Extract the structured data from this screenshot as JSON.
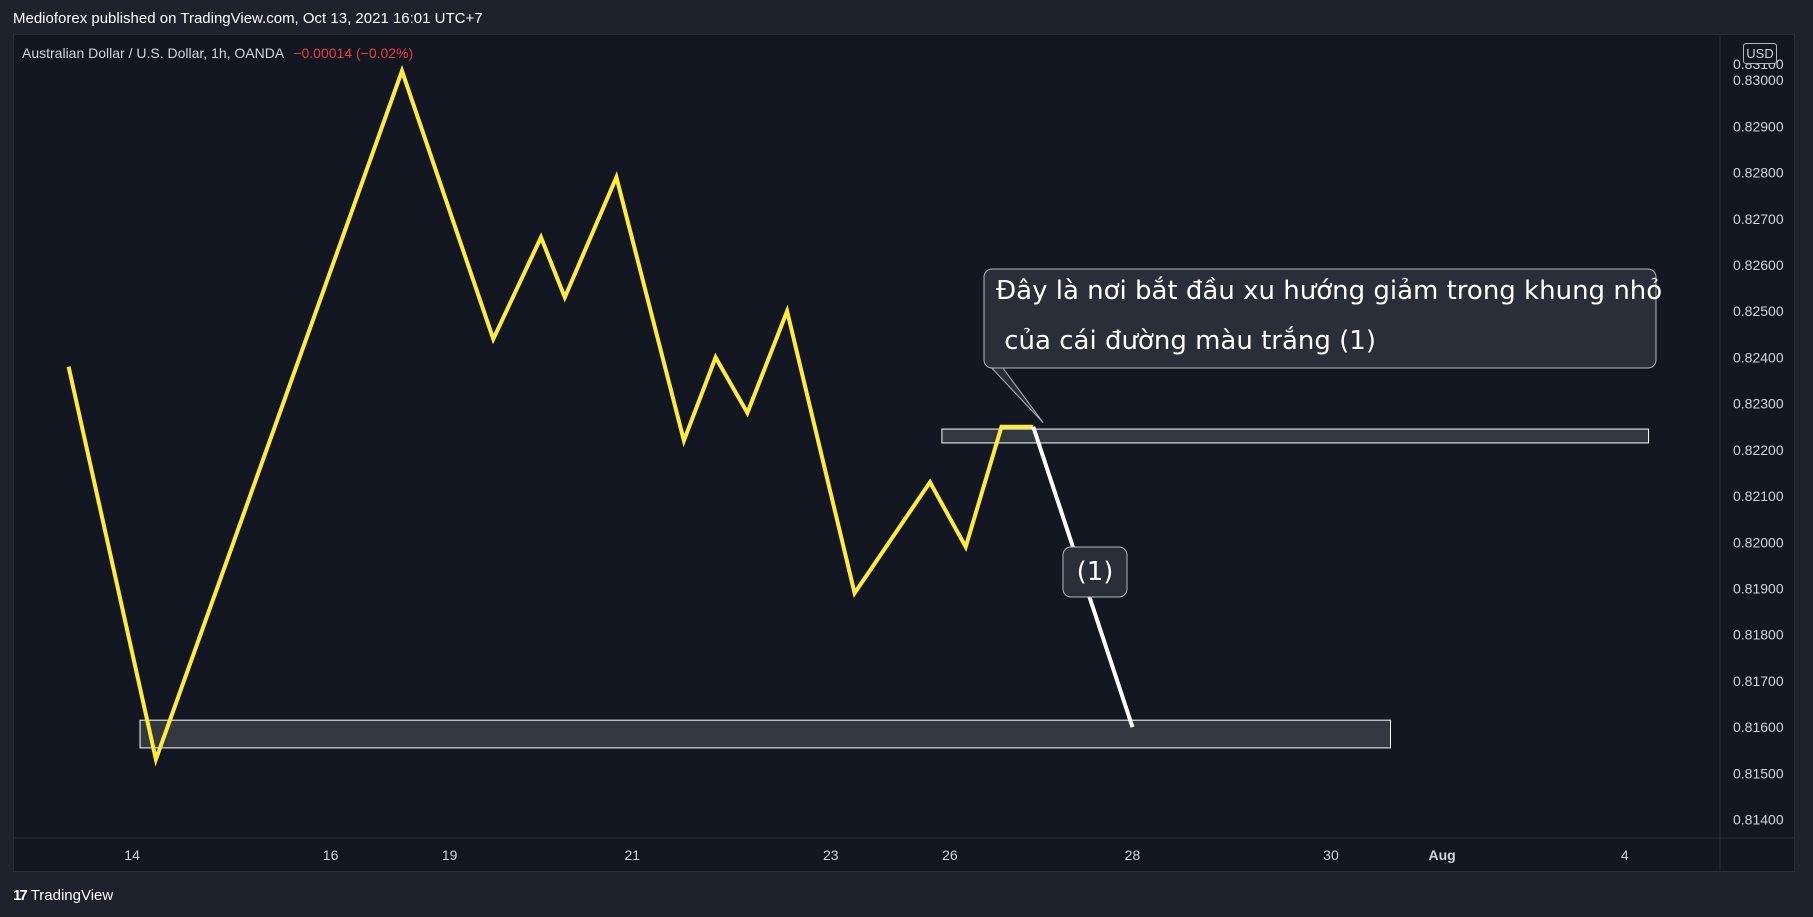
{
  "header": {
    "publisher_line": "Medioforex published on TradingView.com, Oct 13, 2021 16:01 UTC+7"
  },
  "legend": {
    "symbol": "Australian Dollar / U.S. Dollar, 1h, OANDA",
    "change": "−0.00014 (−0.02%)"
  },
  "price_axis": {
    "currency": "USD",
    "top_partial_label": "0.83100"
  },
  "footer": {
    "brand": "TradingView",
    "logo_glyph": "17"
  },
  "colors": {
    "background": "#131722",
    "price_line": "#ffeb3b",
    "projection_line": "#ffffff",
    "zone_fill": "#3a3d45",
    "zone_border": "#ffffff",
    "callout_fill": "#2a2e39",
    "axis_text": "#d1d4dc"
  },
  "chart_data": {
    "type": "line",
    "title": "Australian Dollar / U.S. Dollar, 1h, OANDA",
    "y_ticks": [
      "0.83000",
      "0.82900",
      "0.82800",
      "0.82700",
      "0.82600",
      "0.82500",
      "0.82400",
      "0.82300",
      "0.82200",
      "0.82100",
      "0.82000",
      "0.81900",
      "0.81800",
      "0.81700",
      "0.81600",
      "0.81500",
      "0.81400"
    ],
    "y_tick_values": [
      0.83,
      0.829,
      0.828,
      0.827,
      0.826,
      0.825,
      0.824,
      0.823,
      0.822,
      0.821,
      0.82,
      0.819,
      0.818,
      0.817,
      0.816,
      0.815,
      0.814
    ],
    "x_ticks": [
      "14",
      "16",
      "19",
      "21",
      "23",
      "26",
      "28",
      "30",
      "Aug",
      "4"
    ],
    "x_tick_positions": [
      13.5,
      16.0,
      17.5,
      19.8,
      22.3,
      23.8,
      26.1,
      28.6,
      30.0,
      32.3
    ],
    "ylim": [
      0.8136,
      0.831
    ],
    "xlim": [
      12.0,
      33.5
    ],
    "grid": false,
    "series": [
      {
        "name": "",
        "color": "#ffeb3b",
        "x": [
          12.7,
          13.8,
          16.9,
          18.05,
          18.65,
          18.95,
          19.6,
          20.45,
          20.85,
          21.25,
          21.75,
          22.6,
          23.55,
          24.0,
          24.45,
          24.85
        ],
        "y": [
          0.8238,
          0.8153,
          0.8302,
          0.8244,
          0.8266,
          0.8253,
          0.8279,
          0.8222,
          0.824,
          0.8228,
          0.825,
          0.8189,
          0.8213,
          0.8199,
          0.8225,
          0.8225
        ]
      },
      {
        "name": "",
        "color": "#ffffff",
        "x": [
          24.85,
          26.1
        ],
        "y": [
          0.8225,
          0.816
        ]
      }
    ],
    "zones": [
      {
        "x0": 13.6,
        "x1": 29.35,
        "y0": 0.81555,
        "y1": 0.81615
      },
      {
        "x0": 23.7,
        "x1": 32.6,
        "y0": 0.82215,
        "y1": 0.82245
      }
    ],
    "annotations": [
      {
        "lines": [
          "Đây là nơi bắt đầu xu hướng giảm trong khung nhỏ",
          " của cái đường màu trắng (1)"
        ],
        "anchor_x": 24.85,
        "anchor_y": 0.8225
      },
      {
        "lines": [
          "(1)"
        ],
        "anchor_x": 25.55,
        "anchor_y": 0.8189
      }
    ]
  }
}
